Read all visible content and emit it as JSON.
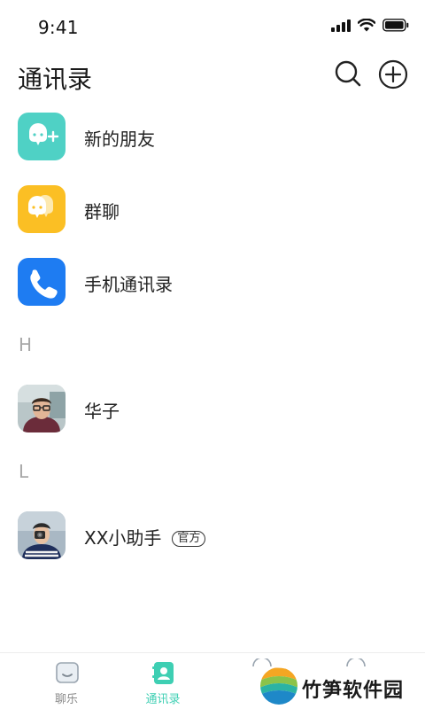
{
  "status_bar": {
    "time": "9:41"
  },
  "header": {
    "title": "通讯录"
  },
  "entries": [
    {
      "label": "新的朋友",
      "icon": "new-friend-icon",
      "color": "#4fd1c5"
    },
    {
      "label": "群聊",
      "icon": "group-chat-icon",
      "color": "#fbbf24"
    },
    {
      "label": "手机通讯录",
      "icon": "phone-icon",
      "color": "#1e7cf2"
    }
  ],
  "sections": [
    {
      "letter": "H",
      "contacts": [
        {
          "name": "华子",
          "badge": ""
        }
      ]
    },
    {
      "letter": "L",
      "contacts": [
        {
          "name": "XX小助手",
          "badge": "官方"
        }
      ]
    }
  ],
  "tabs": [
    {
      "label": "聊乐",
      "icon": "chat-icon",
      "active": false
    },
    {
      "label": "通讯录",
      "icon": "contacts-icon",
      "active": true
    }
  ],
  "watermark": {
    "text": "竹笋软件园"
  },
  "colors": {
    "accent": "#3ecfb3",
    "section_letter": "#a8a8a8"
  }
}
